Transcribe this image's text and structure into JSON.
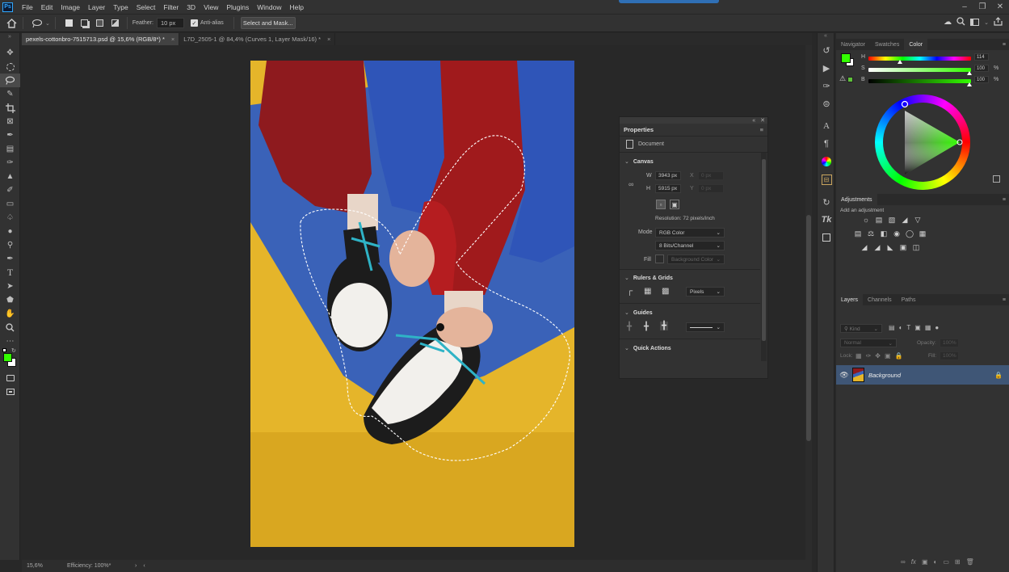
{
  "app": {
    "logo": "Ps"
  },
  "menu": [
    "File",
    "Edit",
    "Image",
    "Layer",
    "Type",
    "Select",
    "Filter",
    "3D",
    "View",
    "Plugins",
    "Window",
    "Help"
  ],
  "options_bar": {
    "feather_label": "Feather:",
    "feather_value": "10 px",
    "antialias_label": "Anti-alias",
    "antialias_checked": true,
    "select_mask_button": "Select and Mask..."
  },
  "tabs": [
    {
      "label": "pexels-cottonbro-7515713.psd @ 15,6% (RGB/8*) *",
      "close": "×"
    },
    {
      "label": "L7D_2505-1 @ 84,4% (Curves 1, Layer Mask/16) *",
      "close": "×"
    }
  ],
  "status": {
    "zoom": "15,6%",
    "info": "Efficiency: 100%*"
  },
  "properties": {
    "title": "Properties",
    "doc_label": "Document",
    "canvas_section": "Canvas",
    "w_label": "W",
    "w_value": "3943 px",
    "h_label": "H",
    "h_value": "5915 px",
    "x_label": "X",
    "x_value": "0 px",
    "y_label": "Y",
    "y_value": "0 px",
    "resolution": "Resolution: 72 pixels/inch",
    "mode_label": "Mode",
    "mode_value": "RGB Color",
    "depth_value": "8 Bits/Channel",
    "fill_label": "Fill",
    "fill_value": "Background Color",
    "rulers_section": "Rulers & Grids",
    "units_value": "Pixels",
    "guides_section": "Guides",
    "quick_actions": "Quick Actions"
  },
  "color_panel": {
    "tabs": [
      "Navigator",
      "Swatches",
      "Color"
    ],
    "active_tab": "Color",
    "h_label": "H",
    "h_value": "114",
    "s_label": "S",
    "s_value": "100",
    "s_unit": "%",
    "b_label": "B",
    "b_value": "100",
    "b_unit": "%",
    "foreground": "#33ff00",
    "background": "#ffffff"
  },
  "adjustments": {
    "title": "Adjustments",
    "hint": "Add an adjustment"
  },
  "layers": {
    "tabs": [
      "Layers",
      "Channels",
      "Paths"
    ],
    "active_tab": "Layers",
    "kind_placeholder": "Kind",
    "blend_mode": "Normal",
    "opacity_label": "Opacity:",
    "opacity_value": "100%",
    "lock_label": "Lock:",
    "fill_label": "Fill:",
    "fill_value": "100%",
    "layer_name": "Background"
  },
  "icons": [
    "move-icon",
    "lasso-icon",
    "crop-icon",
    "brush-icon",
    "type-icon",
    "hand-icon",
    "zoom-icon",
    "eye-icon",
    "lock-icon",
    "search-icon",
    "home-icon",
    "cloud-icon",
    "share-icon"
  ]
}
